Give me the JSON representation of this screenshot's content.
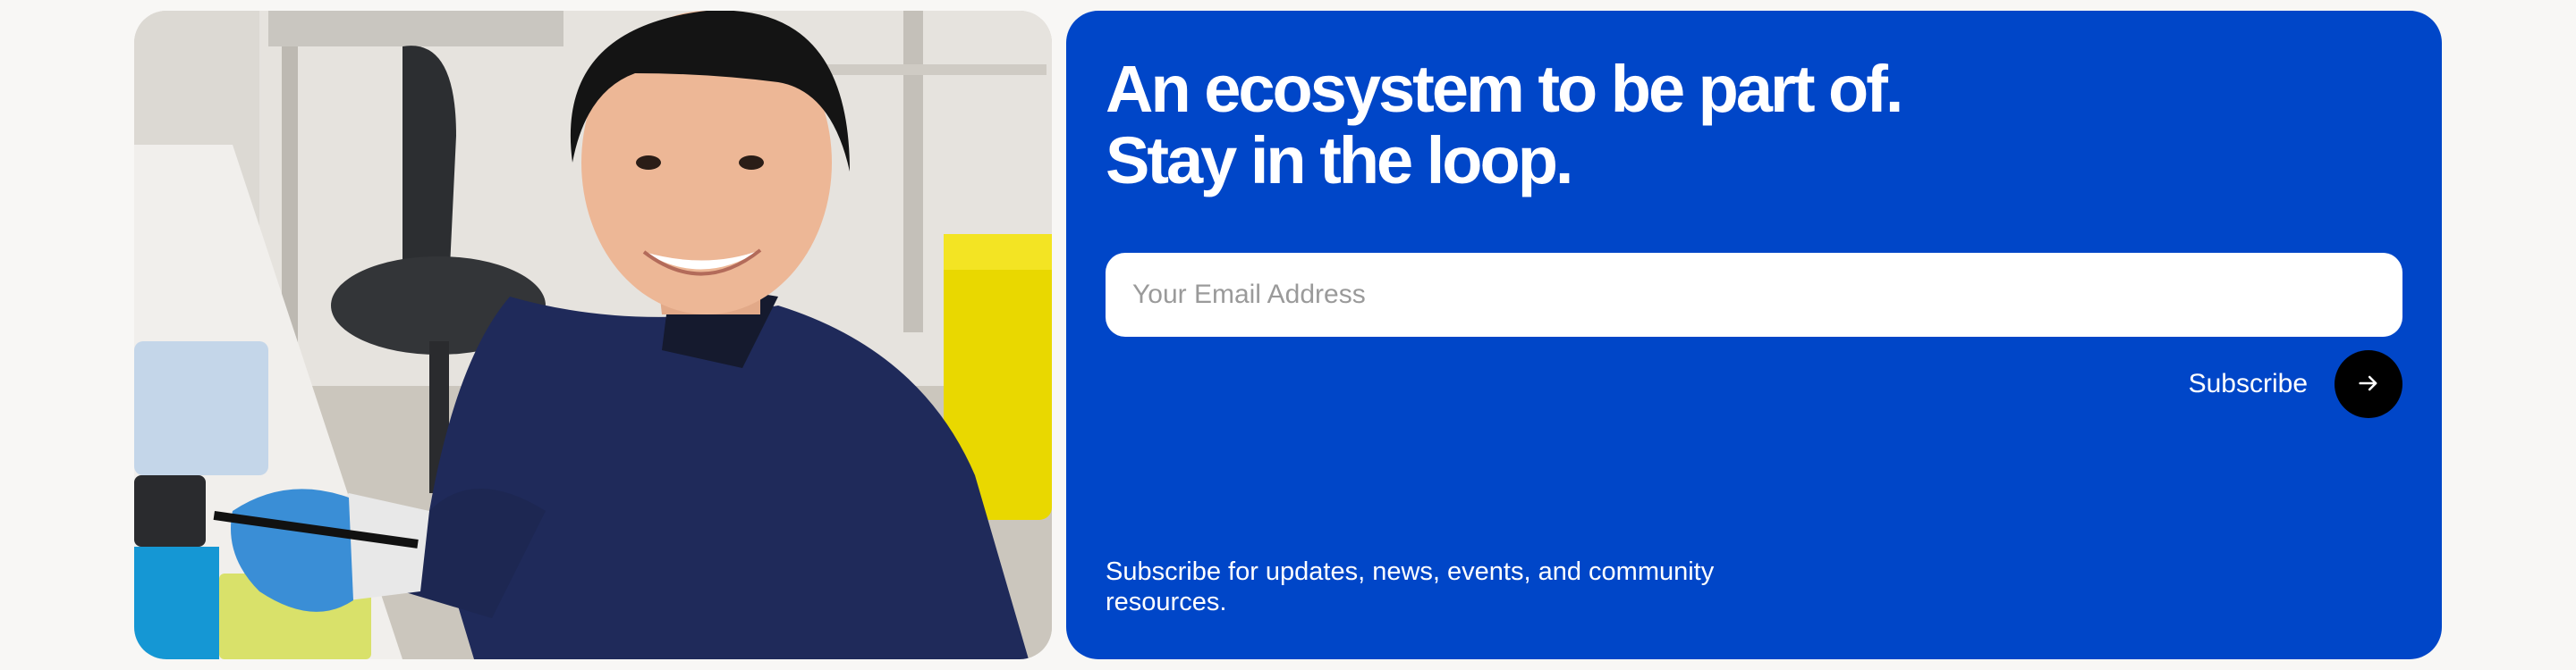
{
  "headline": {
    "line1": "An ecosystem to be part of.",
    "line2": "Stay in the loop."
  },
  "email": {
    "placeholder": "Your Email Address",
    "value": ""
  },
  "subscribe": {
    "label": "Subscribe",
    "icon": "arrow-right-icon"
  },
  "footnote": "Subscribe for updates, news, events, and community resources.",
  "colors": {
    "card": "#0046c8",
    "button": "#000000",
    "page": "#f8f7f5"
  }
}
